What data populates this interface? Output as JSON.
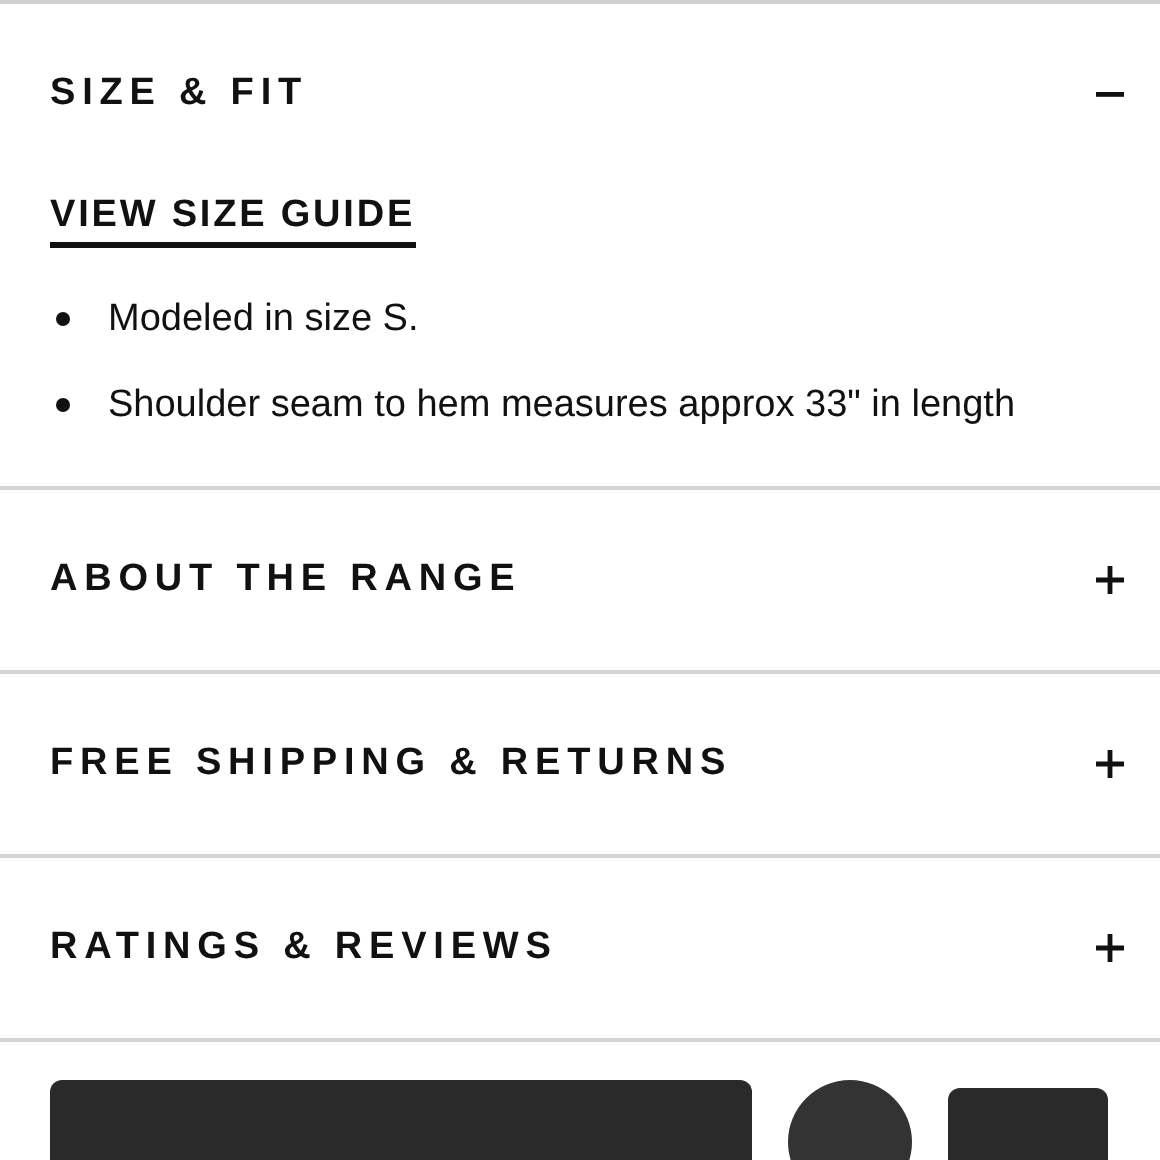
{
  "sections": [
    {
      "title": "SIZE & FIT",
      "expanded": true,
      "link": "VIEW SIZE GUIDE",
      "bullets": [
        "Modeled in size S.",
        "Shoulder seam to hem measures approx 33\" in length"
      ]
    },
    {
      "title": "ABOUT THE RANGE",
      "expanded": false
    },
    {
      "title": "FREE SHIPPING & RETURNS",
      "expanded": false
    },
    {
      "title": "RATINGS & REVIEWS",
      "expanded": false
    }
  ]
}
